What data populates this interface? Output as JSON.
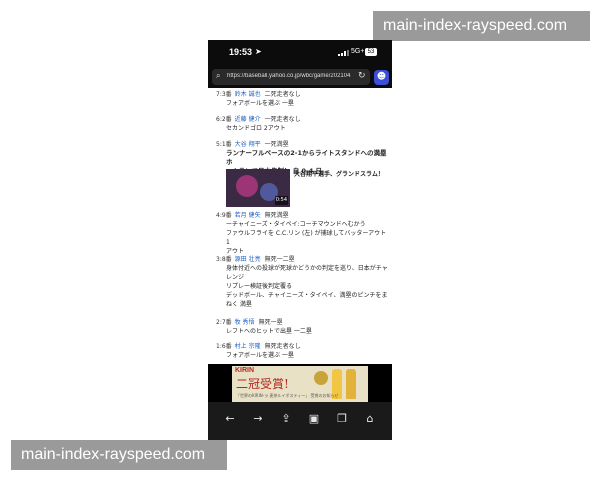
{
  "watermark_top": "main-index-rayspeed.com",
  "watermark_bottom": "main-index-rayspeed.com",
  "status_bar": {
    "time": "19:53",
    "network": "5G+",
    "battery": "53"
  },
  "browser": {
    "url": "https://baseball.yahoo.co.jp/wbc/game/202104..."
  },
  "plays": [
    {
      "num": "7:3番",
      "name": "鈴木 誠也",
      "situation": "二死走者なし",
      "lines": [
        "フォアボールを選ぶ 一塁"
      ]
    },
    {
      "num": "6:2番",
      "name": "近藤 健介",
      "situation": "一死走者なし",
      "lines": [
        "セカンドゴロ 2アウト"
      ]
    },
    {
      "num": "5:1番",
      "name": "大谷 翔平",
      "situation": "一死満塁",
      "headline": [
        "ランナーフルベースの2-1からライトスタンドへの満塁ホ",
        "ームランで日本先制！ 自 0-4 日"
      ],
      "video_caption": "大谷翔平選手、グランドスラム！",
      "video_duration": "0:54"
    },
    {
      "num": "4:9番",
      "name": "若月 健矢",
      "situation": "無死満塁",
      "lines": [
        "ーチャイニーズ・タイペイ:コーチマウンドへむかう",
        "ファウルフライを C.C.リン (左) が捕球してバッターアウト 1",
        "アウト"
      ]
    },
    {
      "num": "3:8番",
      "name": "源田 壮亮",
      "situation": "無死一二塁",
      "lines": [
        "身体付近への投球が死球かどうかの判定を巡り、日本がチャ",
        "レンジ",
        "リプレー検証後判定覆る",
        "デッドボール、チャイニーズ・タイペイ、満塁のピンチをま",
        "ねく 満塁"
      ]
    },
    {
      "num": "2:7番",
      "name": "牧 秀悟",
      "situation": "無死一塁",
      "lines": [
        "レフトへのヒットで出塁 一二塁"
      ]
    },
    {
      "num": "1:6番",
      "name": "村上 宗隆",
      "situation": "無死走者なし",
      "lines": [
        "フォアボールを選ぶ 一塁"
      ]
    }
  ],
  "ad": {
    "brand": "KIRIN",
    "headline": "二冠受賞!",
    "caption": "「世界のKIRIN-ラ 麦茶ルイボスティー」 受賞のお知らせ"
  },
  "toolbar_icons": [
    "back-arrow-icon",
    "forward-arrow-icon",
    "share-icon",
    "bookmarks-icon",
    "tabs-icon",
    "home-icon"
  ]
}
